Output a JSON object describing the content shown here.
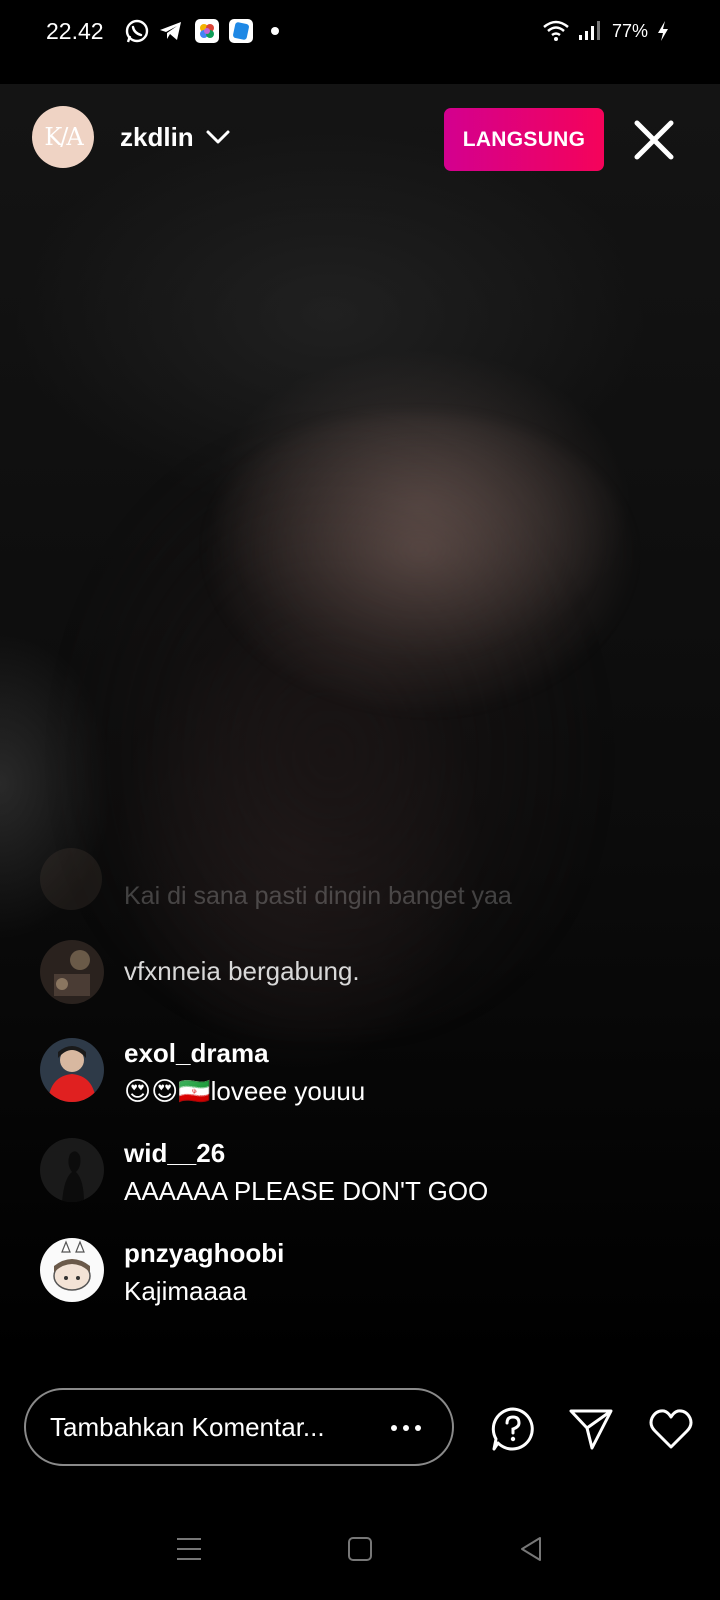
{
  "status_bar": {
    "time": "22.42",
    "battery": "77%",
    "notification_icons": [
      "whatsapp-icon",
      "telegram-icon",
      "photos-icon",
      "app-icon",
      "dot-icon"
    ],
    "right_icons": [
      "wifi-icon",
      "signal-icon",
      "battery-charging-icon"
    ]
  },
  "header": {
    "avatar_monogram": "K/A",
    "username": "zkdlin",
    "live_label": "LANGSUNG"
  },
  "comments": {
    "faded": {
      "text": "Kai di sana pasti dingin banget yaa"
    },
    "system": {
      "text": "vfxnneia bergabung."
    },
    "items": [
      {
        "user": "exol_drama",
        "text": "😍😍🇮🇷loveee youuu"
      },
      {
        "user": "wid__26",
        "text": "AAAAAA PLEASE DON'T GOO"
      },
      {
        "user": "pnzyaghoobi",
        "text": "Kajimaaaa"
      }
    ]
  },
  "bottom_bar": {
    "comment_placeholder": "Tambahkan Komentar...",
    "icons": [
      "more-options-icon",
      "question-icon",
      "send-icon",
      "heart-icon"
    ]
  },
  "nav_bar": {
    "icons": [
      "recent-apps-icon",
      "home-icon",
      "back-icon"
    ]
  },
  "colors": {
    "live_gradient_start": "#d3008f",
    "live_gradient_end": "#f5035a",
    "background": "#000000"
  }
}
